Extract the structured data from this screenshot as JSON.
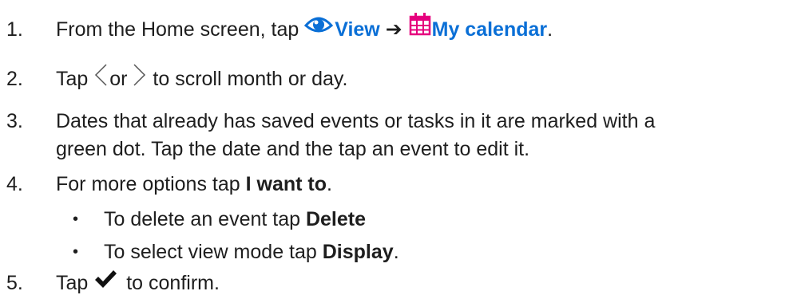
{
  "steps": [
    {
      "number": "1.",
      "prefix": "From the Home screen, tap ",
      "view_label": "View",
      "arrow": "➔",
      "calendar_label": "My calendar",
      "suffix": "."
    },
    {
      "number": "2.",
      "prefix": "Tap ",
      "middle": "or ",
      "suffix": " to scroll month or day."
    },
    {
      "number": "3.",
      "line1": "Dates that already has saved events or tasks in it are marked with a",
      "line2": "green dot. Tap the date and the tap an event to edit it."
    },
    {
      "number": "4.",
      "prefix": "For more options tap ",
      "bold": "I want to",
      "suffix": "."
    },
    {
      "number": "5.",
      "prefix": "Tap ",
      "suffix": " to confirm."
    }
  ],
  "bullets": [
    {
      "marker": "•",
      "prefix": "To delete an event tap ",
      "bold": "Delete",
      "suffix": ""
    },
    {
      "marker": "•",
      "prefix": "To select view mode tap ",
      "bold": "Display",
      "suffix": "."
    }
  ],
  "icons": {
    "view": "eye-icon",
    "calendar": "calendar-icon",
    "previous": "chevron-left-icon",
    "next": "chevron-right-icon",
    "confirm": "checkmark-icon"
  },
  "colors": {
    "text": "#1e1e1e",
    "view_accent": "#0a6fd6",
    "calendar_accent": "#e6007e"
  }
}
